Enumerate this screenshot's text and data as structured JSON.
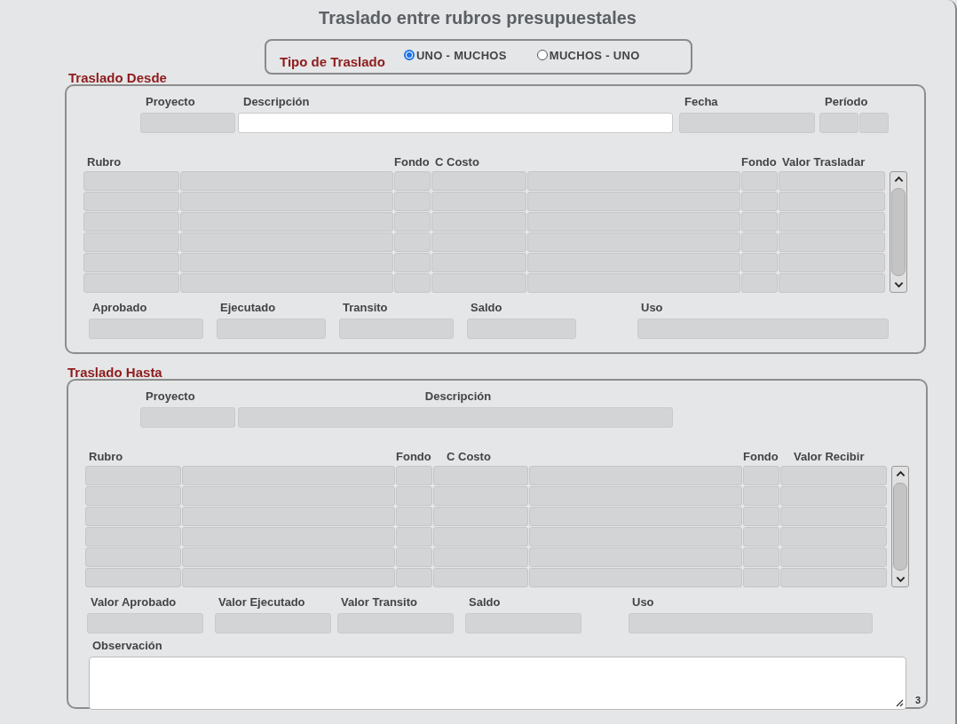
{
  "title": "Traslado entre rubros presupuestales",
  "transfer_type": {
    "label": "Tipo de Traslado",
    "options": [
      {
        "label": "UNO - MUCHOS",
        "selected": true
      },
      {
        "label": "MUCHOS - UNO",
        "selected": false
      }
    ]
  },
  "sections": [
    {
      "title": "Traslado Desde",
      "header": [
        {
          "label": "Proyecto",
          "fields": [
            {
              "disabled": true
            }
          ]
        },
        {
          "label": "Descripción",
          "fields": [
            {
              "disabled": false
            }
          ]
        },
        {
          "label": "Fecha",
          "fields": [
            {
              "disabled": true
            }
          ]
        },
        {
          "label": "Período",
          "fields": [
            {
              "disabled": true
            },
            {
              "disabled": true
            }
          ]
        }
      ],
      "columns": [
        "Rubro",
        "Fondo",
        "C Costo",
        "Fondo",
        "Valor Trasladar"
      ],
      "totals": [
        {
          "label": "Aprobado",
          "disabled": true
        },
        {
          "label": "Ejecutado",
          "disabled": true
        },
        {
          "label": "Transito",
          "disabled": true
        },
        {
          "label": "Saldo",
          "disabled": true
        },
        {
          "label": "Uso",
          "disabled": true
        }
      ]
    },
    {
      "title": "Traslado Hasta",
      "header": [
        {
          "label": "Proyecto",
          "fields": [
            {
              "disabled": true
            }
          ]
        },
        {
          "label": "Descripción",
          "fields": [
            {
              "disabled": true
            }
          ]
        }
      ],
      "columns": [
        "Rubro",
        "Fondo",
        "C Costo",
        "Fondo",
        "Valor Recibir"
      ],
      "totals": [
        {
          "label": "Valor Aprobado",
          "disabled": true
        },
        {
          "label": "Valor Ejecutado",
          "disabled": true
        },
        {
          "label": "Valor Transito",
          "disabled": true
        },
        {
          "label": "Saldo",
          "disabled": true
        },
        {
          "label": "Uso",
          "disabled": true
        }
      ],
      "observation": {
        "label": "Observación",
        "counter": "3"
      }
    }
  ]
}
